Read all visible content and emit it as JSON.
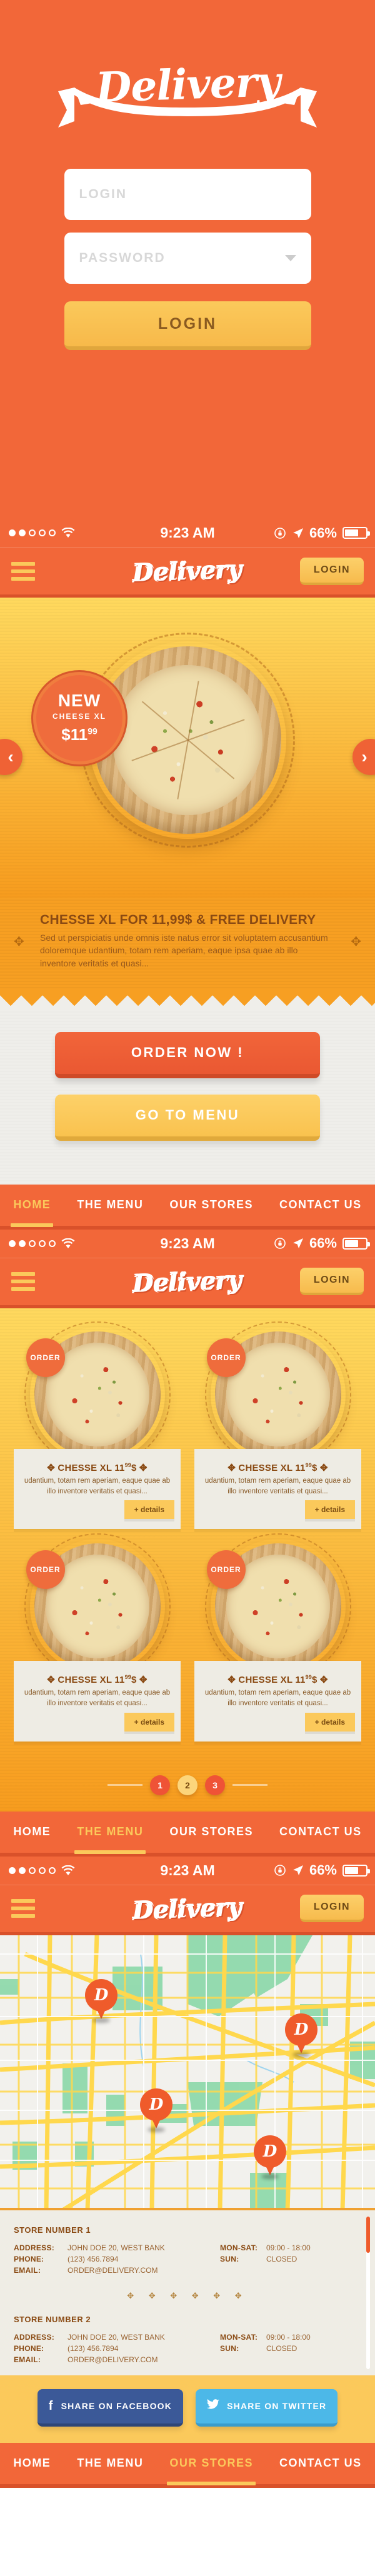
{
  "brand": {
    "name": "Delivery",
    "accent_orange": "#f26739",
    "accent_yellow": "#fbc95b",
    "accent_red": "#ef5336"
  },
  "login_screen": {
    "logo": "Delivery",
    "username_placeholder": "LOGIN",
    "password_placeholder": "PASSWORD",
    "submit_label": "LOGIN"
  },
  "statusbar": {
    "carrier_signal": "••ooo",
    "wifi_icon": "wifi-icon",
    "time": "9:23 AM",
    "rotation_lock_icon": "rotation-lock-icon",
    "location_icon": "location-arrow-icon",
    "battery_percent": "66%",
    "battery_icon": "battery-icon"
  },
  "header": {
    "menu_icon": "hamburger-menu-icon",
    "logo": "Delivery",
    "login_label": "LOGIN"
  },
  "nav": {
    "items": [
      {
        "label": "HOME"
      },
      {
        "label": "THE MENU"
      },
      {
        "label": "OUR STORES"
      },
      {
        "label": "CONTACT US"
      }
    ],
    "active_home": 0,
    "active_menu": 1,
    "active_stores": 2
  },
  "home_screen": {
    "badge": {
      "new": "NEW",
      "product": "CHEESE XL",
      "price_main": "$11",
      "price_cents": "99"
    },
    "carousel": {
      "prev_icon": "chevron-left-icon",
      "next_icon": "chevron-right-icon"
    },
    "caption": {
      "title": "CHESSE XL FOR  11,99$ & FREE DELIVERY",
      "body": "Sed ut perspiciatis unde omnis iste natus error sit voluptatem accusantium doloremque udantium, totam rem aperiam, eaque ipsa quae ab illo inventore veritatis et quasi...",
      "ornament": "✥"
    },
    "cta_primary": "ORDER NOW !",
    "cta_secondary": "GO TO MENU"
  },
  "menu_screen": {
    "cards": [
      {
        "order_label": "ORDER",
        "title_pre": "✥ CHESSE XL  11",
        "title_sup": "99",
        "title_post": "$ ✥",
        "desc": "udantium, totam rem aperiam, eaque quae ab illo inventore veritatis et quasi...",
        "details": "+ details"
      },
      {
        "order_label": "ORDER",
        "title_pre": "✥ CHESSE XL  11",
        "title_sup": "99",
        "title_post": "$ ✥",
        "desc": "udantium, totam rem aperiam, eaque quae ab illo inventore veritatis et quasi...",
        "details": "+ details"
      },
      {
        "order_label": "ORDER",
        "title_pre": "✥ CHESSE XL  11",
        "title_sup": "99",
        "title_post": "$ ✥",
        "desc": "udantium, totam rem aperiam, eaque quae ab illo inventore veritatis et quasi...",
        "details": "+ details"
      },
      {
        "order_label": "ORDER",
        "title_pre": "✥ CHESSE XL  11",
        "title_sup": "99",
        "title_post": "$ ✥",
        "desc": "udantium, totam rem aperiam, eaque quae ab illo inventore veritatis et quasi...",
        "details": "+ details"
      }
    ],
    "pagination": [
      {
        "label": "1",
        "active": false
      },
      {
        "label": "2",
        "active": true
      },
      {
        "label": "3",
        "active": false
      }
    ]
  },
  "stores_screen": {
    "map": {
      "pin_glyph": "D",
      "pin_count": 4
    },
    "labels": {
      "address": "ADDRESS:",
      "phone": "PHONE:",
      "email": "EMAIL:",
      "weekday": "MON-SAT:",
      "sunday": "SUN:"
    },
    "divider_ornaments": "✥ ✥ ✥ ✥ ✥ ✥",
    "stores": [
      {
        "name": "STORE NUMBER 1",
        "address": "JOHN DOE 20, WEST BANK",
        "phone": "(123) 456.7894",
        "email": "ORDER@DELIVERY.COM",
        "weekday_hours": "09:00 - 18:00",
        "sunday_hours": "CLOSED"
      },
      {
        "name": "STORE NUMBER 2",
        "address": "JOHN DOE 20, WEST BANK",
        "phone": "(123) 456.7894",
        "email": "ORDER@DELIVERY.COM",
        "weekday_hours": "09:00 - 18:00",
        "sunday_hours": "CLOSED"
      }
    ],
    "social": {
      "facebook_label": "SHARE ON FACEBOOK",
      "facebook_icon": "facebook-icon",
      "facebook_glyph": "f",
      "twitter_label": "SHARE ON TWITTER",
      "twitter_icon": "twitter-icon",
      "twitter_glyph": "🐦"
    }
  }
}
